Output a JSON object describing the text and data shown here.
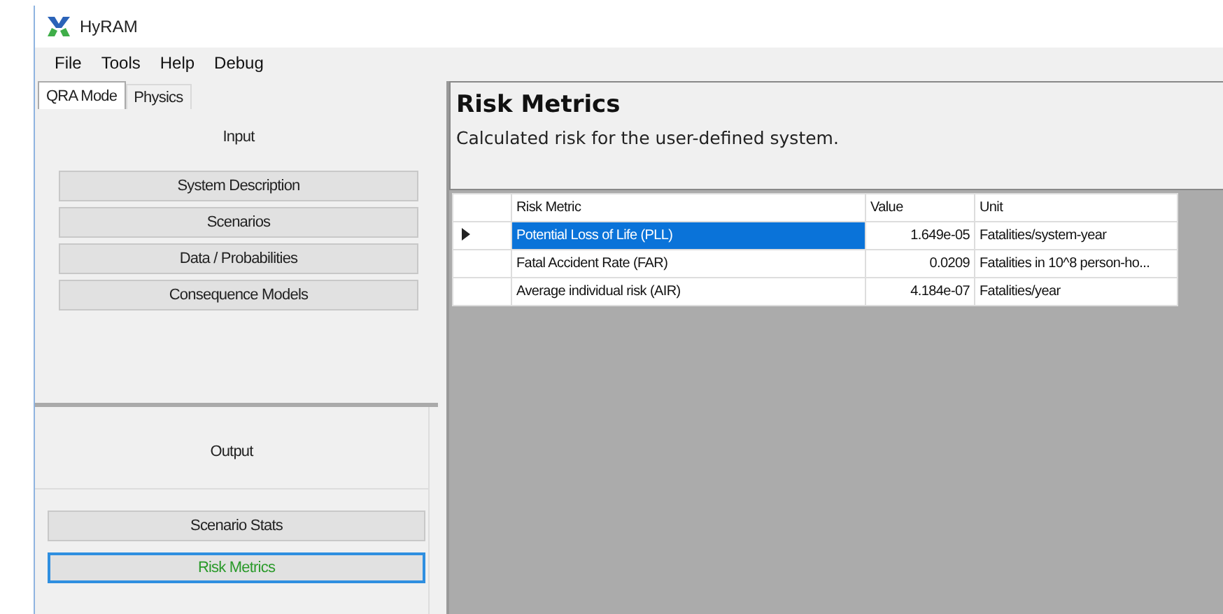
{
  "window": {
    "title": "HyRAM"
  },
  "menu": [
    "File",
    "Tools",
    "Help",
    "Debug"
  ],
  "tabs": [
    {
      "label": "QRA Mode",
      "selected": true
    },
    {
      "label": "Physics",
      "selected": false
    }
  ],
  "input": {
    "heading": "Input",
    "buttons": [
      {
        "label": "System Description",
        "selected": false
      },
      {
        "label": "Scenarios",
        "selected": false
      },
      {
        "label": "Data / Probabilities",
        "selected": false
      },
      {
        "label": "Consequence Models",
        "selected": false
      }
    ]
  },
  "output": {
    "heading": "Output",
    "buttons": [
      {
        "label": "Scenario Stats",
        "selected": false
      },
      {
        "label": "Risk Metrics",
        "selected": true
      }
    ]
  },
  "page": {
    "title": "Risk Metrics",
    "subtitle": "Calculated risk for the user-defined system."
  },
  "table": {
    "columns": [
      "Risk Metric",
      "Value",
      "Unit"
    ],
    "rows": [
      {
        "cells": [
          "Potential Loss of Life (PLL)",
          "1.649e-05",
          "Fatalities/system-year"
        ],
        "selected": true
      },
      {
        "cells": [
          "Fatal Accident Rate (FAR)",
          "0.0209",
          "Fatalities in 10^8 person-ho..."
        ],
        "selected": false
      },
      {
        "cells": [
          "Average individual risk (AIR)",
          "4.184e-07",
          "Fatalities/year"
        ],
        "selected": false
      }
    ]
  }
}
